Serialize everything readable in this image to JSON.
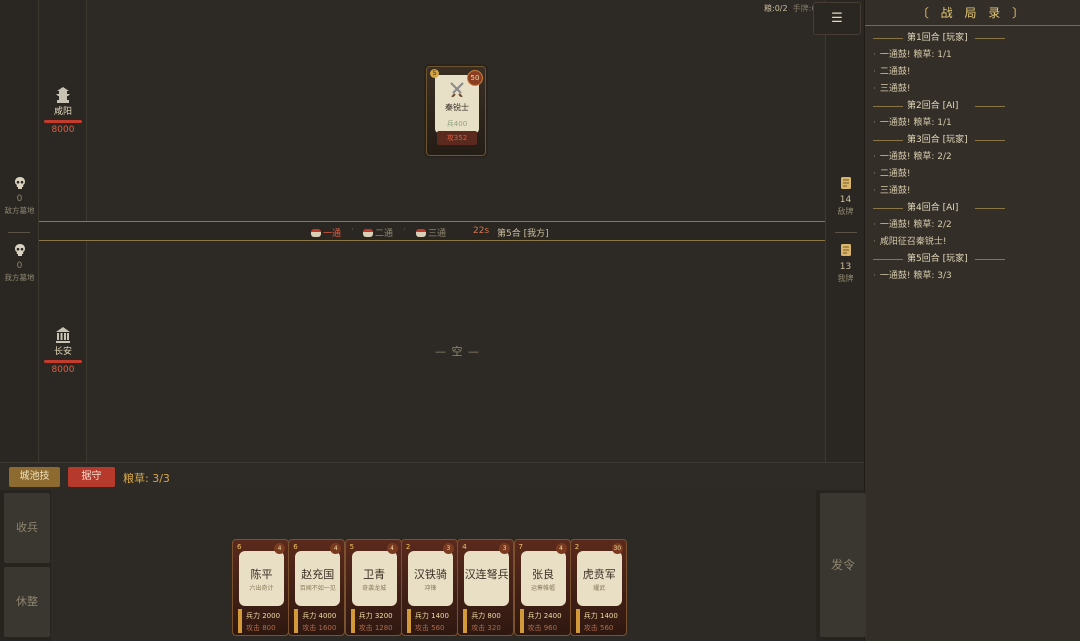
{
  "top_status": {
    "food": "粮:0/2",
    "hand": "手牌:6"
  },
  "menu_icon": "☰",
  "graves": {
    "enemy": {
      "count": "0",
      "label": "敌方墓地"
    },
    "mine": {
      "count": "0",
      "label": "我方墓地"
    }
  },
  "cities": {
    "enemy": {
      "name": "咸阳",
      "hp": "8000"
    },
    "mine": {
      "name": "长安",
      "hp": "8000"
    }
  },
  "decks": {
    "enemy": {
      "count": "14",
      "label": "敌牌"
    },
    "mine": {
      "count": "13",
      "label": "我牌"
    }
  },
  "field_card": {
    "cost": "5",
    "power": "50",
    "name": "秦锐士",
    "stat1": "兵400",
    "stat2": "攻352"
  },
  "drum_beats": [
    {
      "label": "一通",
      "active": true
    },
    {
      "label": "二通",
      "active": false
    },
    {
      "label": "三通",
      "active": false
    }
  ],
  "timer": "22s",
  "round_label": "第5合 [我方]",
  "my_field_empty": "— 空 —",
  "actions": {
    "city_skill": "城池技",
    "hold": "据守",
    "food": "粮草: 3/3"
  },
  "side_buttons": {
    "recall": "收兵",
    "rest": "休整",
    "order": "发令"
  },
  "hand": [
    {
      "cost": "6",
      "power": "4",
      "name": "陈平",
      "sub": "六出奇计",
      "troops": "兵力 2000",
      "attack": "攻击 800"
    },
    {
      "cost": "6",
      "power": "4",
      "name": "赵充国",
      "sub": "百闻不如一见",
      "troops": "兵力 4000",
      "attack": "攻击 1600"
    },
    {
      "cost": "5",
      "power": "4",
      "name": "卫青",
      "sub": "奇袭龙城",
      "troops": "兵力 3200",
      "attack": "攻击 1280"
    },
    {
      "cost": "2",
      "power": "3",
      "name": "汉铁骑",
      "sub": "冲锋",
      "troops": "兵力 1400",
      "attack": "攻击 560"
    },
    {
      "cost": "4",
      "power": "3",
      "name": "汉连弩兵",
      "sub": "",
      "troops": "兵力 800",
      "attack": "攻击 320"
    },
    {
      "cost": "7",
      "power": "4",
      "name": "张良",
      "sub": "运筹帷幄",
      "troops": "兵力 2400",
      "attack": "攻击 960"
    },
    {
      "cost": "2",
      "power": "30",
      "name": "虎贲军",
      "sub": "耀武",
      "troops": "兵力 1400",
      "attack": "攻击 560"
    }
  ],
  "log": {
    "title": "〔 战 局 录 〕",
    "lines": [
      {
        "type": "round",
        "text": "第1回合 [玩家]"
      },
      {
        "type": "entry",
        "text": "一通鼓! 粮草: 1/1"
      },
      {
        "type": "entry",
        "text": "二通鼓!"
      },
      {
        "type": "entry",
        "text": "三通鼓!"
      },
      {
        "type": "round",
        "text": "第2回合 [AI]"
      },
      {
        "type": "entry",
        "text": "一通鼓! 粮草: 1/1"
      },
      {
        "type": "round",
        "text": "第3回合 [玩家]"
      },
      {
        "type": "entry",
        "text": "一通鼓! 粮草: 2/2"
      },
      {
        "type": "entry",
        "text": "二通鼓!"
      },
      {
        "type": "entry",
        "text": "三通鼓!"
      },
      {
        "type": "round",
        "text": "第4回合 [AI]"
      },
      {
        "type": "entry",
        "text": "一通鼓! 粮草: 2/2"
      },
      {
        "type": "entry",
        "text": "咸阳征召秦锐士!"
      },
      {
        "type": "round",
        "text": "第5回合 [玩家]"
      },
      {
        "type": "entry",
        "text": "一通鼓! 粮草: 3/3"
      }
    ]
  },
  "colors": {
    "accent_gold": "#e6c978",
    "hold_red": "#b53a2c",
    "hp_red": "#c43a2c"
  }
}
